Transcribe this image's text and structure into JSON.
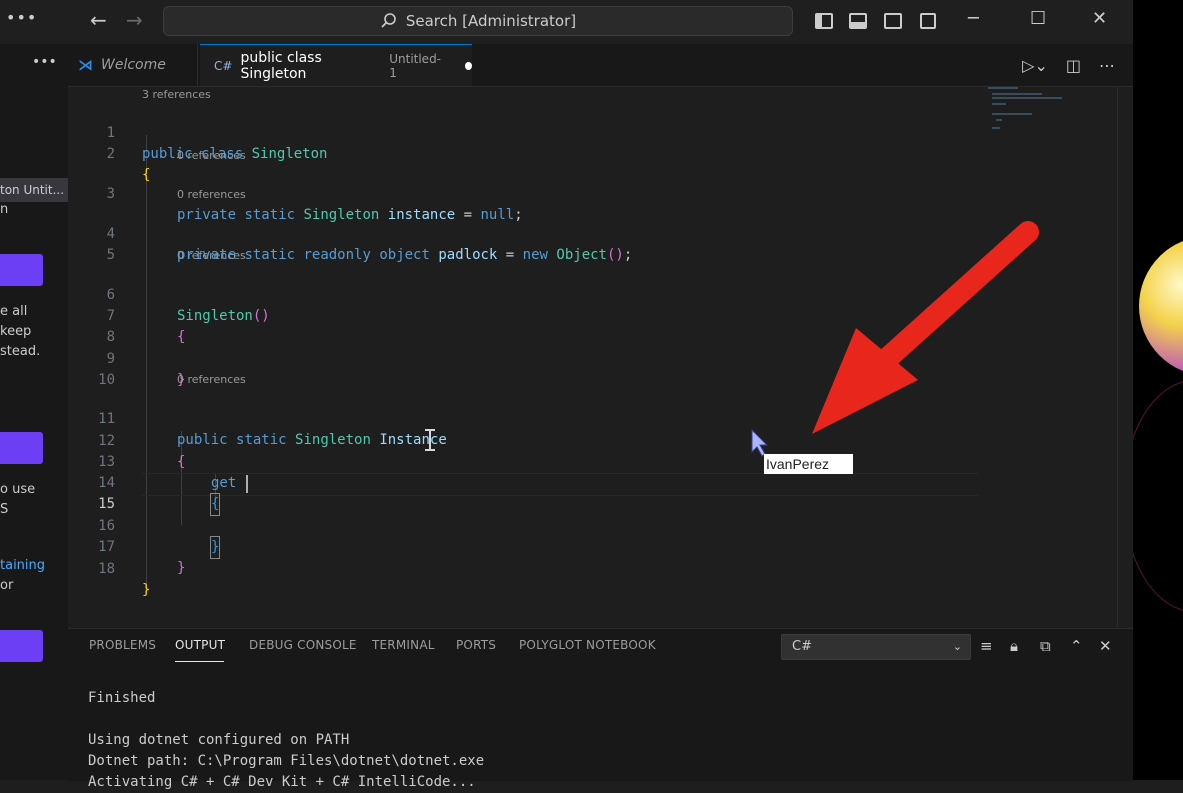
{
  "titlebar": {
    "search_text": "Search [Administrator]",
    "more_icon": "ellipsis-icon",
    "back_icon": "arrow-left-icon",
    "forward_icon": "arrow-right-icon",
    "minimize": "─",
    "maximize": "☐",
    "close": "✕"
  },
  "sidepanel": {
    "selected_item": "ton  Untit...",
    "texts": [
      "n",
      "e all",
      "keep",
      "stead.",
      "o use",
      "S",
      "taining",
      "or"
    ]
  },
  "tabs": [
    {
      "label": "Welcome"
    },
    {
      "label": "public class Singleton",
      "sub": "Untitled-1"
    }
  ],
  "editor": {
    "lines": [
      {
        "n": "1",
        "lens": "3 references"
      },
      {
        "n": "2"
      },
      {
        "n": "3",
        "lens": "0 references"
      },
      {
        "n": "4",
        "lens": "0 references"
      },
      {
        "n": "5"
      },
      {
        "n": "6",
        "lens": "0 references"
      },
      {
        "n": "7"
      },
      {
        "n": "8"
      },
      {
        "n": "9"
      },
      {
        "n": "10"
      },
      {
        "n": "11",
        "lens": "0 references"
      },
      {
        "n": "12"
      },
      {
        "n": "13"
      },
      {
        "n": "14"
      },
      {
        "n": "15"
      },
      {
        "n": "16"
      },
      {
        "n": "17"
      },
      {
        "n": "18"
      }
    ],
    "tokens": {
      "public": "public",
      "class": "class",
      "Singleton": "Singleton",
      "private": "private",
      "static": "static",
      "readonly": "readonly",
      "object": "object",
      "instance": "instance",
      "eq": " = ",
      "null": "null",
      "semi": ";",
      "padlock": "padlock",
      "new": "new",
      "Object": "Object",
      "parens": "()",
      "Instance": "Instance",
      "get": "get",
      "lb": "{",
      "rb": "}"
    }
  },
  "cursor_label": "IvanPerez",
  "panel": {
    "tabs": [
      "PROBLEMS",
      "OUTPUT",
      "DEBUG CONSOLE",
      "TERMINAL",
      "PORTS",
      "POLYGLOT NOTEBOOK"
    ],
    "active_tab": "OUTPUT",
    "selected_channel": "C#",
    "output": [
      "Finished",
      "",
      "Using dotnet configured on PATH",
      "Dotnet path: C:\\Program Files\\dotnet\\dotnet.exe",
      "Activating C# + C# Dev Kit + C# IntelliCode..."
    ]
  },
  "colors": {
    "accent": "#0078d4",
    "button_purple": "#6c3ff5",
    "annotation_arrow": "#e8261c"
  }
}
